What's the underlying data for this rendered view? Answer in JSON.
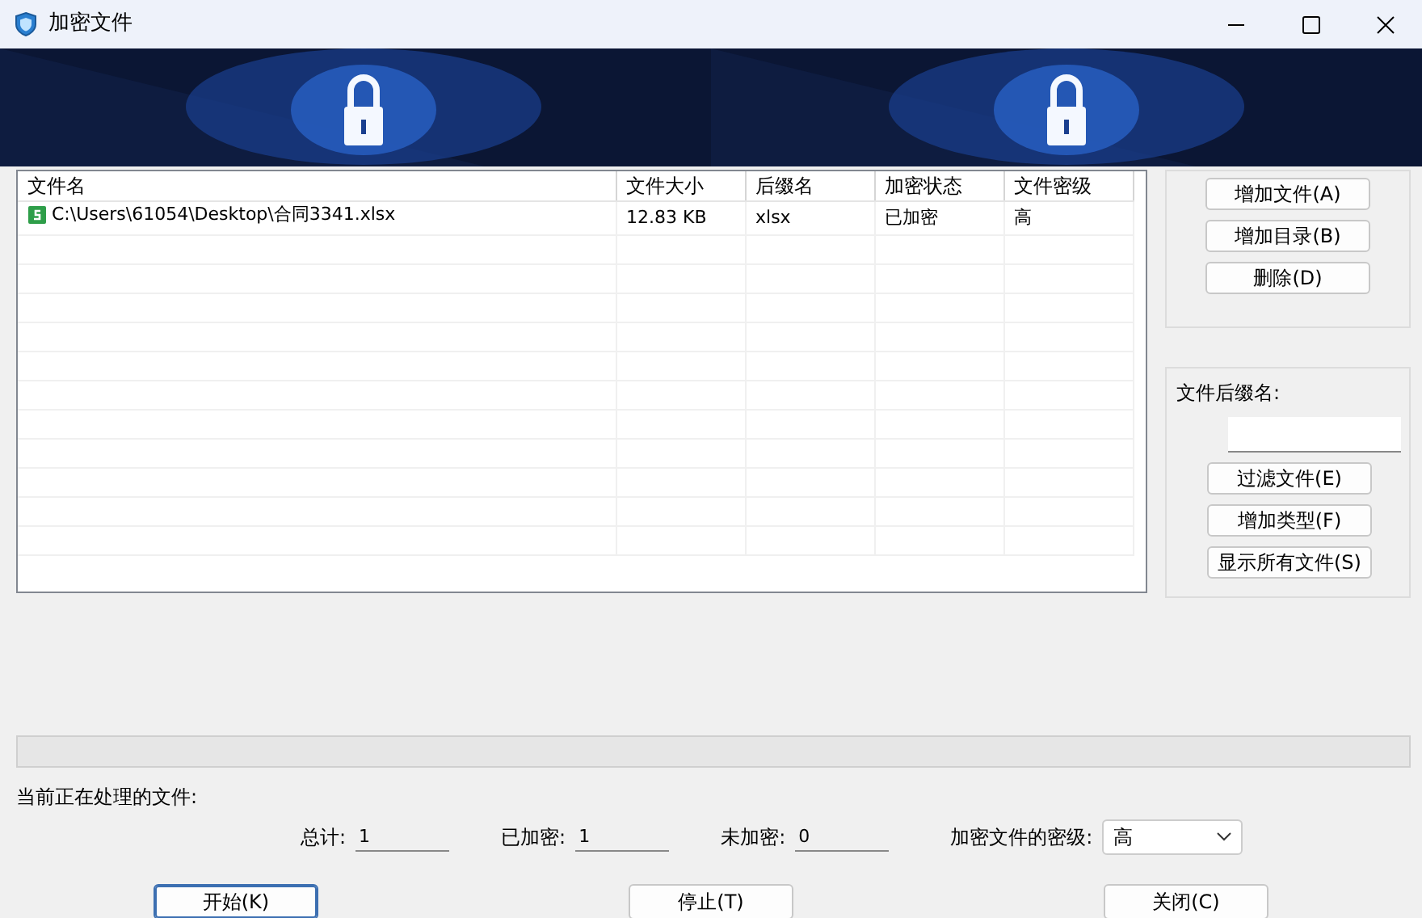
{
  "window": {
    "title": "加密文件"
  },
  "table": {
    "columns": [
      "文件名",
      "文件大小",
      "后缀名",
      "加密状态",
      "文件密级"
    ],
    "rows": [
      {
        "cells": [
          "C:\\Users\\61054\\Desktop\\合同3341.xlsx",
          "12.83 KB",
          "xlsx",
          "已加密",
          "高"
        ]
      }
    ]
  },
  "file_buttons": [
    "增加文件(A)",
    "增加目录(B)",
    "删除(D)"
  ],
  "filter": {
    "label": "文件后缀名:",
    "buttons": [
      "过滤文件(E)",
      "增加类型(F)",
      "显示所有文件(S)"
    ]
  },
  "progress": {
    "level": 0
  },
  "status": "当前正在处理的文件:",
  "counters": [
    {
      "label": "总计:",
      "value": "1"
    },
    {
      "label": "已加密:",
      "value": "1"
    },
    {
      "label": "未加密:",
      "value": "0"
    }
  ],
  "level_select": {
    "label": "加密文件的密级:",
    "value": "高"
  },
  "actions": [
    {
      "label": "开始(K)",
      "selected": true
    },
    {
      "label": "停止(T)",
      "selected": false
    },
    {
      "label": "关闭(C)",
      "selected": false
    }
  ]
}
